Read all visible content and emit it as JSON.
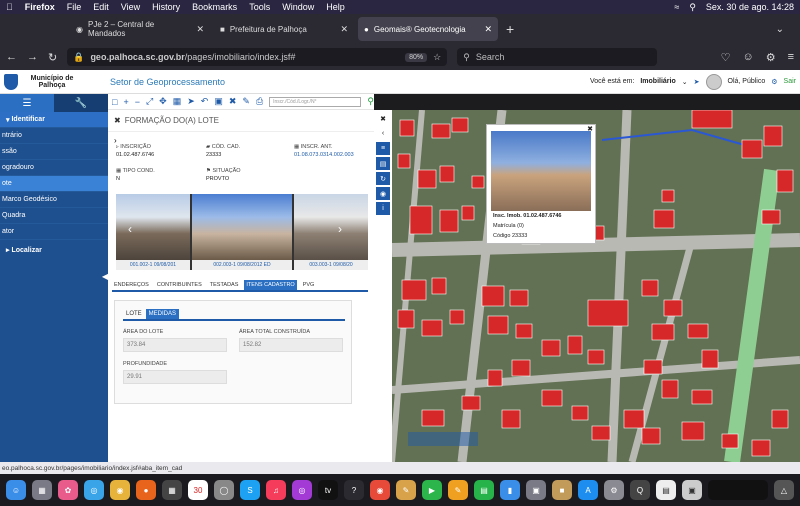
{
  "menubar": {
    "apple": "",
    "app": "Firefox",
    "items": [
      "File",
      "Edit",
      "View",
      "History",
      "Bookmarks",
      "Tools",
      "Window",
      "Help"
    ],
    "clock": "Sex. 30 de ago.  14:28"
  },
  "tabs": [
    {
      "label": "PJe 2 – Central de Mandados"
    },
    {
      "label": "Prefeitura de Palhoça"
    },
    {
      "label": "Geomais® Geotecnologia"
    }
  ],
  "nav": {
    "url_host": "geo.palhoca.sc.gov.br",
    "url_path": "/pages/imobiliario/index.jsf#",
    "zoom": "80%",
    "search_placeholder": "Search"
  },
  "header": {
    "municipio": "Município de Palhoça",
    "setor": "Setor de Geoprocessamento",
    "voce_esta": "Você está em:",
    "modulo": "Imobiliário",
    "user": "Olá, Público",
    "sair": "Sair"
  },
  "sidebar": {
    "identificar": "Identificar",
    "items": [
      "ntrário",
      "ssão",
      "ogradouro",
      "ote",
      "Marco Geodésico",
      "Quadra",
      "ator"
    ],
    "selected_index": 3,
    "localizar": "Localizar"
  },
  "toolbar": {
    "search_placeholder": "Inscr./Cód./Logr./N°"
  },
  "info": {
    "title": "FORMAÇÃO DO(A) LOTE",
    "fields": [
      {
        "label": "INSCRIÇÃO",
        "value": "01.02.487.6746"
      },
      {
        "label": "CÓD. CAD.",
        "value": "23333"
      },
      {
        "label": "INSCR. ANT.",
        "value": "01.08.073.0314.002.003"
      },
      {
        "label": "TIPO COND.",
        "value": "N"
      },
      {
        "label": "SITUAÇÃO",
        "value": "PROVTO"
      }
    ],
    "photo_captions": [
      "001.002-1 09/08/201",
      "002.003-1 09/08/2012 ED",
      "003.003-1 09/08/20"
    ],
    "subtabs": [
      "ENDEREÇOS",
      "CONTRIBUINTES",
      "TESTADAS",
      "ITENS CADASTRO",
      "PVG"
    ],
    "active_subtab": 3,
    "card_tabs": [
      "LOTE",
      "MEDIDAS"
    ],
    "area_lote_label": "ÁREA DO LOTE",
    "area_lote_value": "373.84",
    "area_total_label": "ÁREA TOTAL CONSTRUÍDA",
    "area_total_value": "152.82",
    "profundidade_label": "PROFUNDIDADE",
    "profundidade_value": "29.91"
  },
  "popup": {
    "insc": "Insc. Imob. 01.02.487.6746",
    "matricula": "Matrícula (0)",
    "codigo": "Código 23333"
  },
  "status_url": "eo.palhoca.sc.gov.br/pages/imobiliario/index.jsf#aba_item_cad",
  "dock_calendar_day": "30",
  "colors": {
    "accent": "#1e5aa8",
    "building": "#d62828"
  }
}
